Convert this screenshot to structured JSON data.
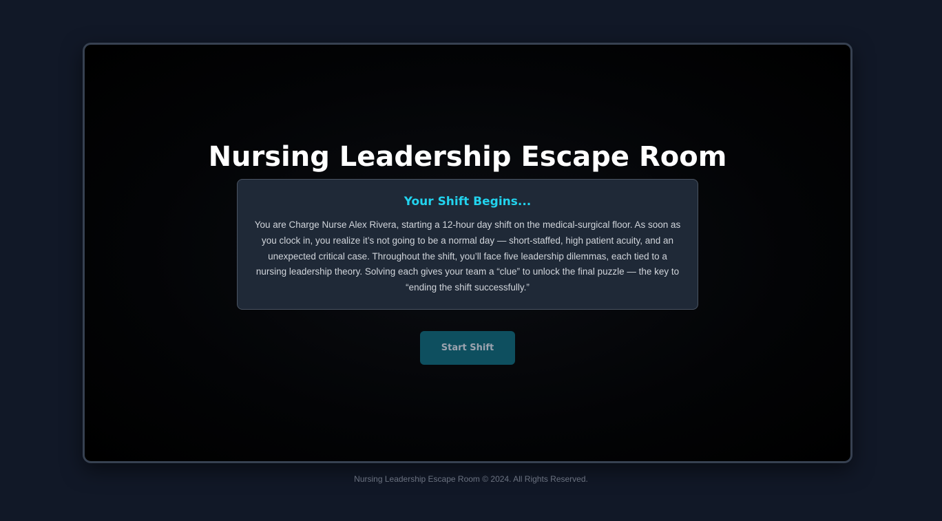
{
  "game": {
    "title": "Nursing Leadership Escape Room",
    "intro": {
      "heading": "Your Shift Begins...",
      "text": "You are Charge Nurse Alex Rivera, starting a 12-hour day shift on the medical-surgical floor. As soon as you clock in, you realize it’s not going to be a normal day — short-staffed, high patient acuity, and an unexpected critical case. Throughout the shift, you’ll face five leadership dilemmas, each tied to a nursing leadership theory. Solving each gives your team a “clue” to unlock the final puzzle — the key to “ending the shift successfully.”"
    },
    "start_button_label": "Start Shift"
  },
  "footer": {
    "text": "Nursing Leadership Escape Room © 2024. All Rights Reserved."
  },
  "colors": {
    "page_background": "#111827",
    "frame_border": "#374151",
    "card_background": "#1f2937",
    "heading_accent": "#22d3ee",
    "button_background": "#0e4f5f"
  }
}
